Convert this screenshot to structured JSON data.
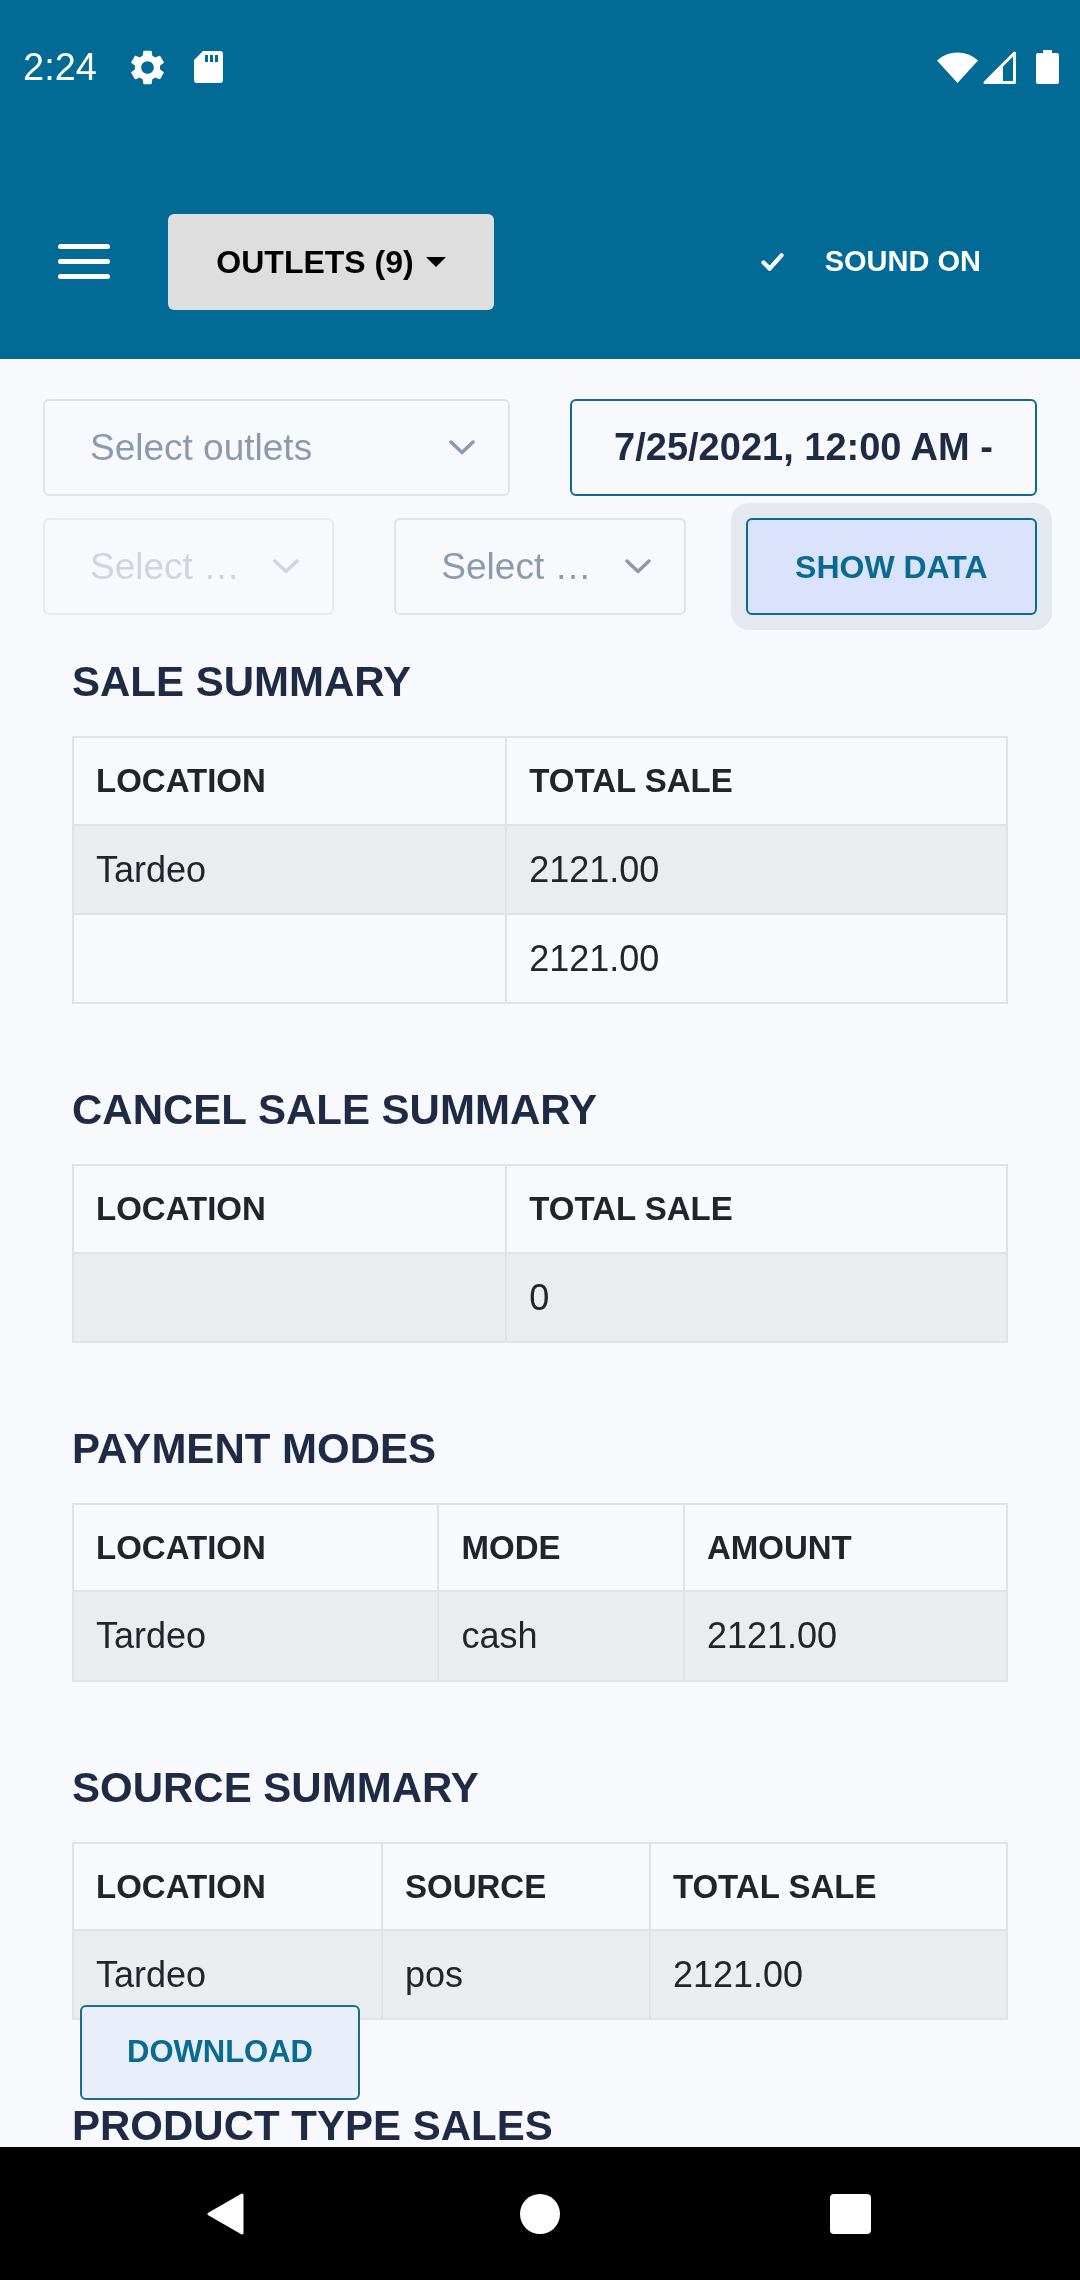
{
  "status_bar": {
    "time": "2:24"
  },
  "toolbar": {
    "outlets_button": "OUTLETS (9)",
    "sound_toggle": {
      "label": "SOUND ON",
      "checked": true
    }
  },
  "filter_rows": [
    [
      {
        "kind": "select",
        "placeholder": "Select outlets",
        "disabled": false
      },
      {
        "kind": "date",
        "value": "7/25/2021, 12:00 AM -"
      }
    ],
    [
      {
        "kind": "select",
        "placeholder": "Select …",
        "disabled": true
      },
      {
        "kind": "select",
        "placeholder": "Select …",
        "disabled": false
      },
      {
        "kind": "button",
        "label": "SHOW DATA",
        "focused": true
      }
    ]
  ],
  "sections": [
    {
      "title": "SALE SUMMARY",
      "table": {
        "columns": [
          "LOCATION",
          "TOTAL SALE"
        ],
        "rows": [
          [
            "Tardeo",
            "2121.00"
          ],
          [
            null,
            "2121.00"
          ]
        ]
      }
    },
    {
      "title": "CANCEL SALE SUMMARY",
      "table": {
        "columns": [
          "LOCATION",
          "TOTAL SALE"
        ],
        "rows": [
          [
            null,
            "0"
          ]
        ]
      }
    },
    {
      "title": "PAYMENT MODES",
      "table": {
        "columns": [
          "LOCATION",
          "MODE",
          "AMOUNT"
        ],
        "rows": [
          [
            "Tardeo",
            "cash",
            "2121.00"
          ]
        ]
      }
    },
    {
      "title": "SOURCE SUMMARY",
      "table": {
        "columns": [
          "LOCATION",
          "SOURCE",
          "TOTAL SALE"
        ],
        "rows": [
          [
            "Tardeo",
            "pos",
            "2121.00"
          ]
        ]
      }
    },
    {
      "title": "PRODUCT TYPE SALES"
    }
  ],
  "download_button": "DOWNLOAD"
}
